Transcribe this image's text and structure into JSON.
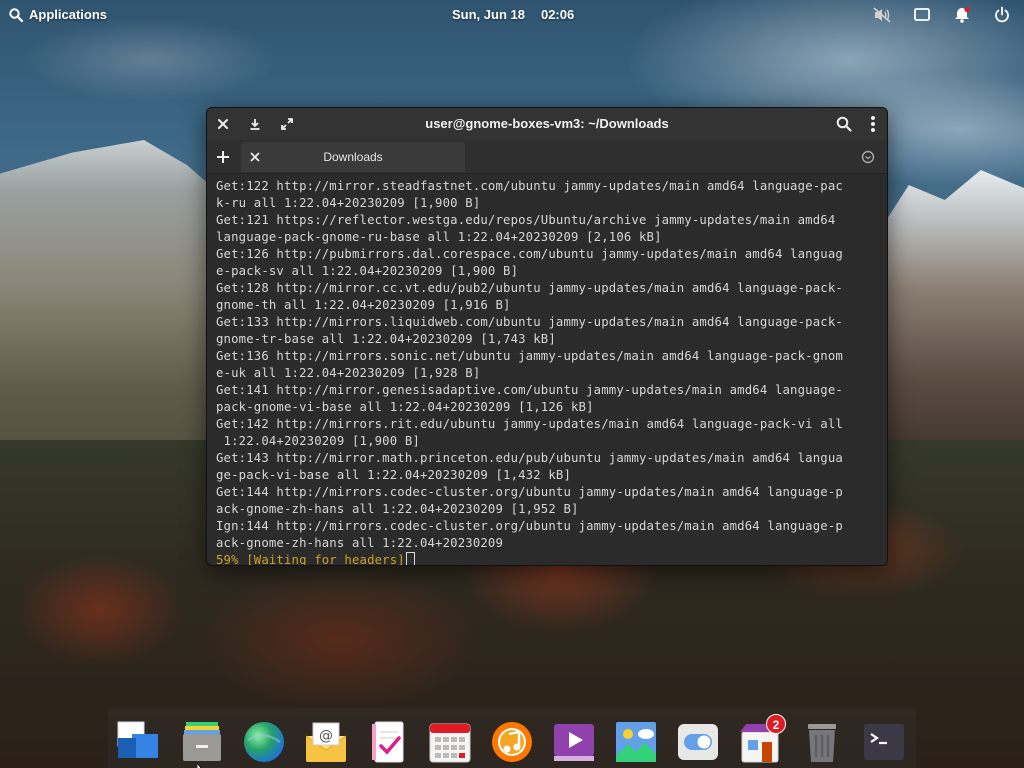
{
  "topbar": {
    "applications_label": "Applications",
    "date": "Sun, Jun 18",
    "time": "02:06",
    "indicators": [
      "audio-muted-icon",
      "display-icon",
      "notifications-icon",
      "power-icon"
    ]
  },
  "terminal": {
    "title": "user@gnome-boxes-vm3: ~/Downloads",
    "tab_label": "Downloads",
    "lines": [
      "Get:122 http://mirror.steadfastnet.com/ubuntu jammy-updates/main amd64 language-pac",
      "k-ru all 1:22.04+20230209 [1,900 B]",
      "Get:121 https://reflector.westga.edu/repos/Ubuntu/archive jammy-updates/main amd64",
      "language-pack-gnome-ru-base all 1:22.04+20230209 [2,106 kB]",
      "Get:126 http://pubmirrors.dal.corespace.com/ubuntu jammy-updates/main amd64 languag",
      "e-pack-sv all 1:22.04+20230209 [1,900 B]",
      "Get:128 http://mirror.cc.vt.edu/pub2/ubuntu jammy-updates/main amd64 language-pack-",
      "gnome-th all 1:22.04+20230209 [1,916 B]",
      "Get:133 http://mirrors.liquidweb.com/ubuntu jammy-updates/main amd64 language-pack-",
      "gnome-tr-base all 1:22.04+20230209 [1,743 kB]",
      "Get:136 http://mirrors.sonic.net/ubuntu jammy-updates/main amd64 language-pack-gnom",
      "e-uk all 1:22.04+20230209 [1,928 B]",
      "Get:141 http://mirror.genesisadaptive.com/ubuntu jammy-updates/main amd64 language-",
      "pack-gnome-vi-base all 1:22.04+20230209 [1,126 kB]",
      "Get:142 http://mirrors.rit.edu/ubuntu jammy-updates/main amd64 language-pack-vi all",
      " 1:22.04+20230209 [1,900 B]",
      "Get:143 http://mirror.math.princeton.edu/pub/ubuntu jammy-updates/main amd64 langua",
      "ge-pack-vi-base all 1:22.04+20230209 [1,432 kB]",
      "Get:144 http://mirrors.codec-cluster.org/ubuntu jammy-updates/main amd64 language-p",
      "ack-gnome-zh-hans all 1:22.04+20230209 [1,952 B]",
      "Ign:144 http://mirrors.codec-cluster.org/ubuntu jammy-updates/main amd64 language-p",
      "ack-gnome-zh-hans all 1:22.04+20230209"
    ],
    "status_line": "59% [Waiting for headers]"
  },
  "dock": {
    "items": [
      {
        "name": "multitasking-view-icon"
      },
      {
        "name": "files-icon"
      },
      {
        "name": "web-browser-icon"
      },
      {
        "name": "mail-icon"
      },
      {
        "name": "tasks-icon"
      },
      {
        "name": "calendar-icon"
      },
      {
        "name": "music-icon"
      },
      {
        "name": "videos-icon"
      },
      {
        "name": "photos-icon"
      },
      {
        "name": "settings-icon"
      },
      {
        "name": "appcenter-icon",
        "badge": "2"
      },
      {
        "name": "trash-icon"
      },
      {
        "name": "terminal-icon"
      }
    ]
  },
  "colors": {
    "terminal_bg": "#2b2b2b",
    "terminal_text": "#d6d6d6",
    "status_text": "#c9a227",
    "badge": "#e01b24"
  }
}
